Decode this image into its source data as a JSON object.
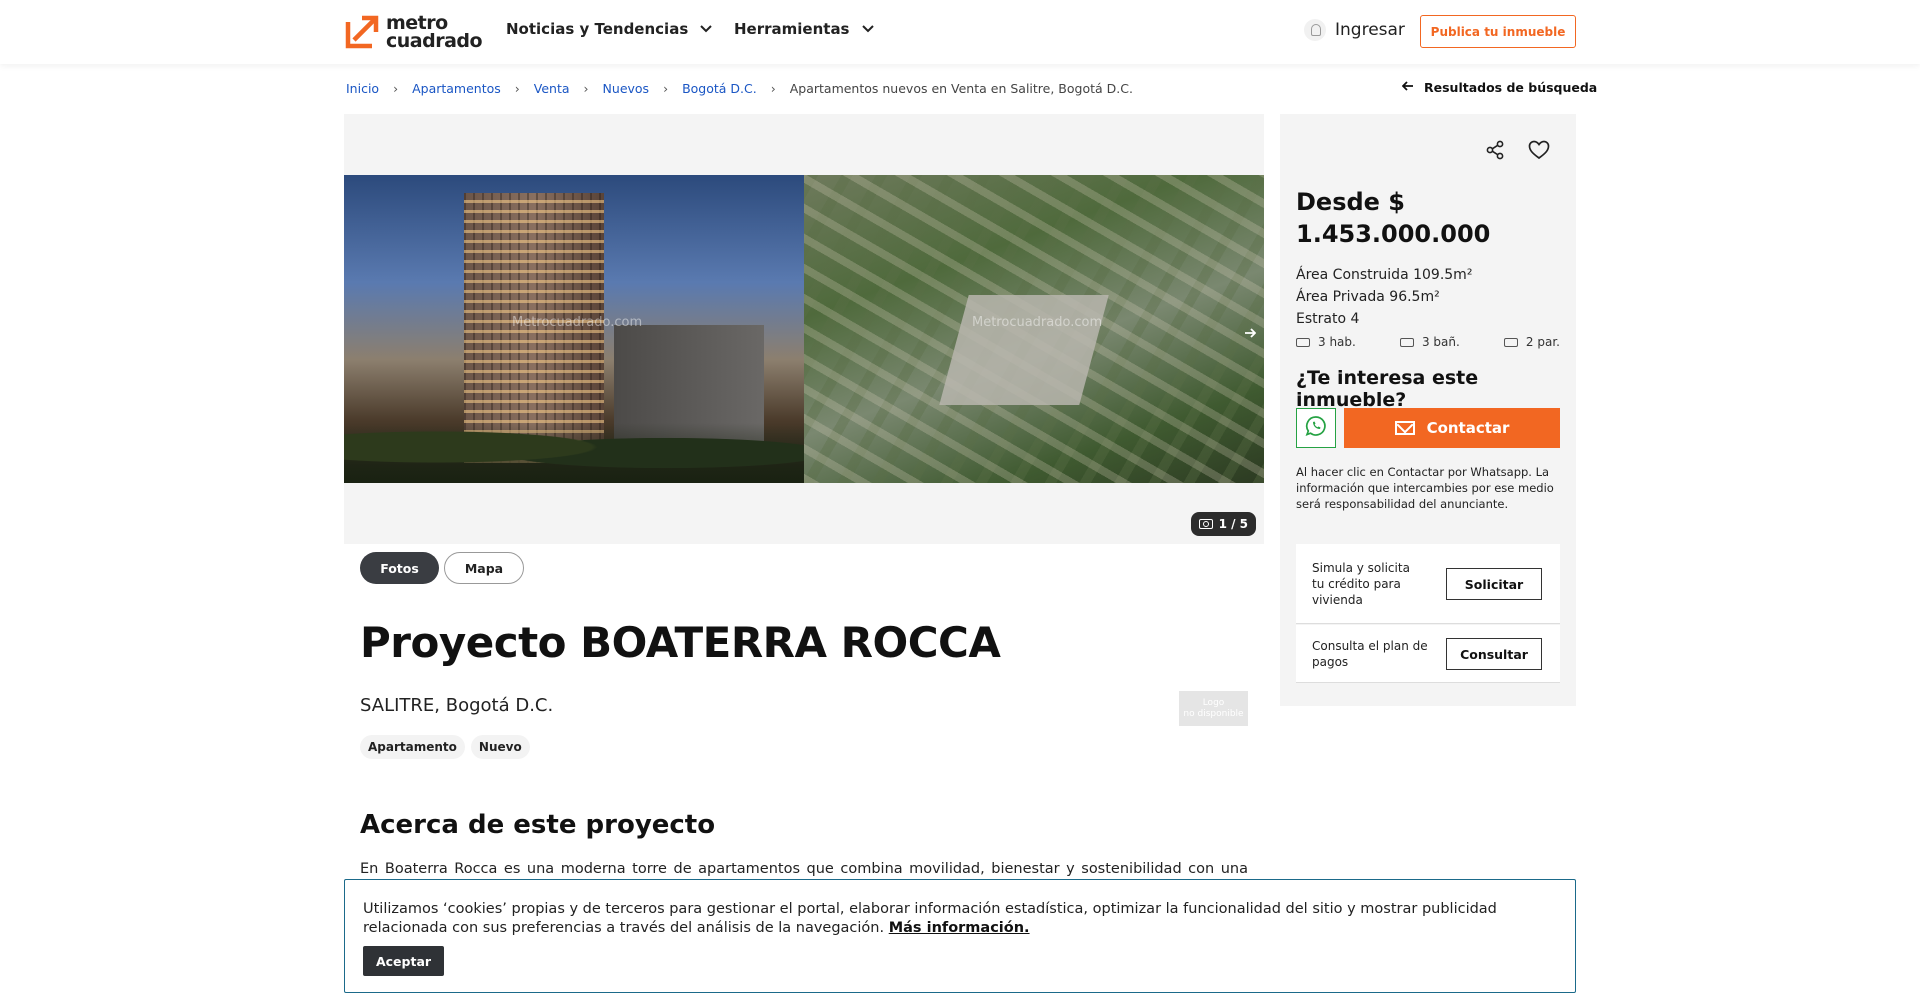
{
  "header": {
    "logo_line1": "metro",
    "logo_line2": "cuadrado",
    "nav": [
      {
        "label": "Noticias y Tendencias"
      },
      {
        "label": "Herramientas"
      }
    ],
    "login_label": "Ingresar",
    "publish_label": "Publica tu inmueble",
    "accent_color": "#f26722"
  },
  "breadcrumb": {
    "items": [
      "Inicio",
      "Apartamentos",
      "Venta",
      "Nuevos",
      "Bogotá D.C."
    ],
    "current": "Apartamentos nuevos en Venta en Salitre, Bogotá D.C.",
    "back_label": "Resultados de búsqueda"
  },
  "gallery": {
    "watermark": "Metrocuadrado.com",
    "counter": "1 / 5"
  },
  "view_tabs": {
    "photos": "Fotos",
    "map": "Mapa"
  },
  "listing": {
    "title": "Proyecto BOATERRA ROCCA",
    "location": "SALITRE, Bogotá D.C.",
    "logo_placeholder_line1": "Logo",
    "logo_placeholder_line2": "no disponible",
    "tags": [
      "Apartamento",
      "Nuevo"
    ],
    "about_title": "Acerca de este proyecto",
    "about_text": "En Boaterra Rocca es una moderna torre de apartamentos que combina movilidad, bienestar y sostenibilidad con una"
  },
  "sidebar": {
    "price": "Desde $ 1.453.000.000",
    "built_area": "Área Construida 109.5m²",
    "private_area": "Área Privada 96.5m²",
    "stratum": "Estrato 4",
    "rooms": "3 hab.",
    "baths": "3 bañ.",
    "parking": "2 par.",
    "interest_title": "¿Te interesa este inmueble?",
    "contact_label": "Contactar",
    "disclaimer": "Al hacer clic en Contactar por Whatsapp. La información que intercambies por ese medio será responsabilidad del anunciante.",
    "offers": [
      {
        "text": "Simula y solicita tu crédito para vivienda",
        "button": "Solicitar"
      },
      {
        "text": "Consulta el plan de pagos",
        "button": "Consultar"
      }
    ]
  },
  "cookie_banner": {
    "text": "Utilizamos ‘cookies’ propias y de terceros para gestionar el portal, elaborar información estadística, optimizar la funcionalidad del sitio y mostrar publicidad relacionada con sus preferencias a través del análisis de la navegación.",
    "link": "Más información.",
    "accept": "Aceptar"
  }
}
